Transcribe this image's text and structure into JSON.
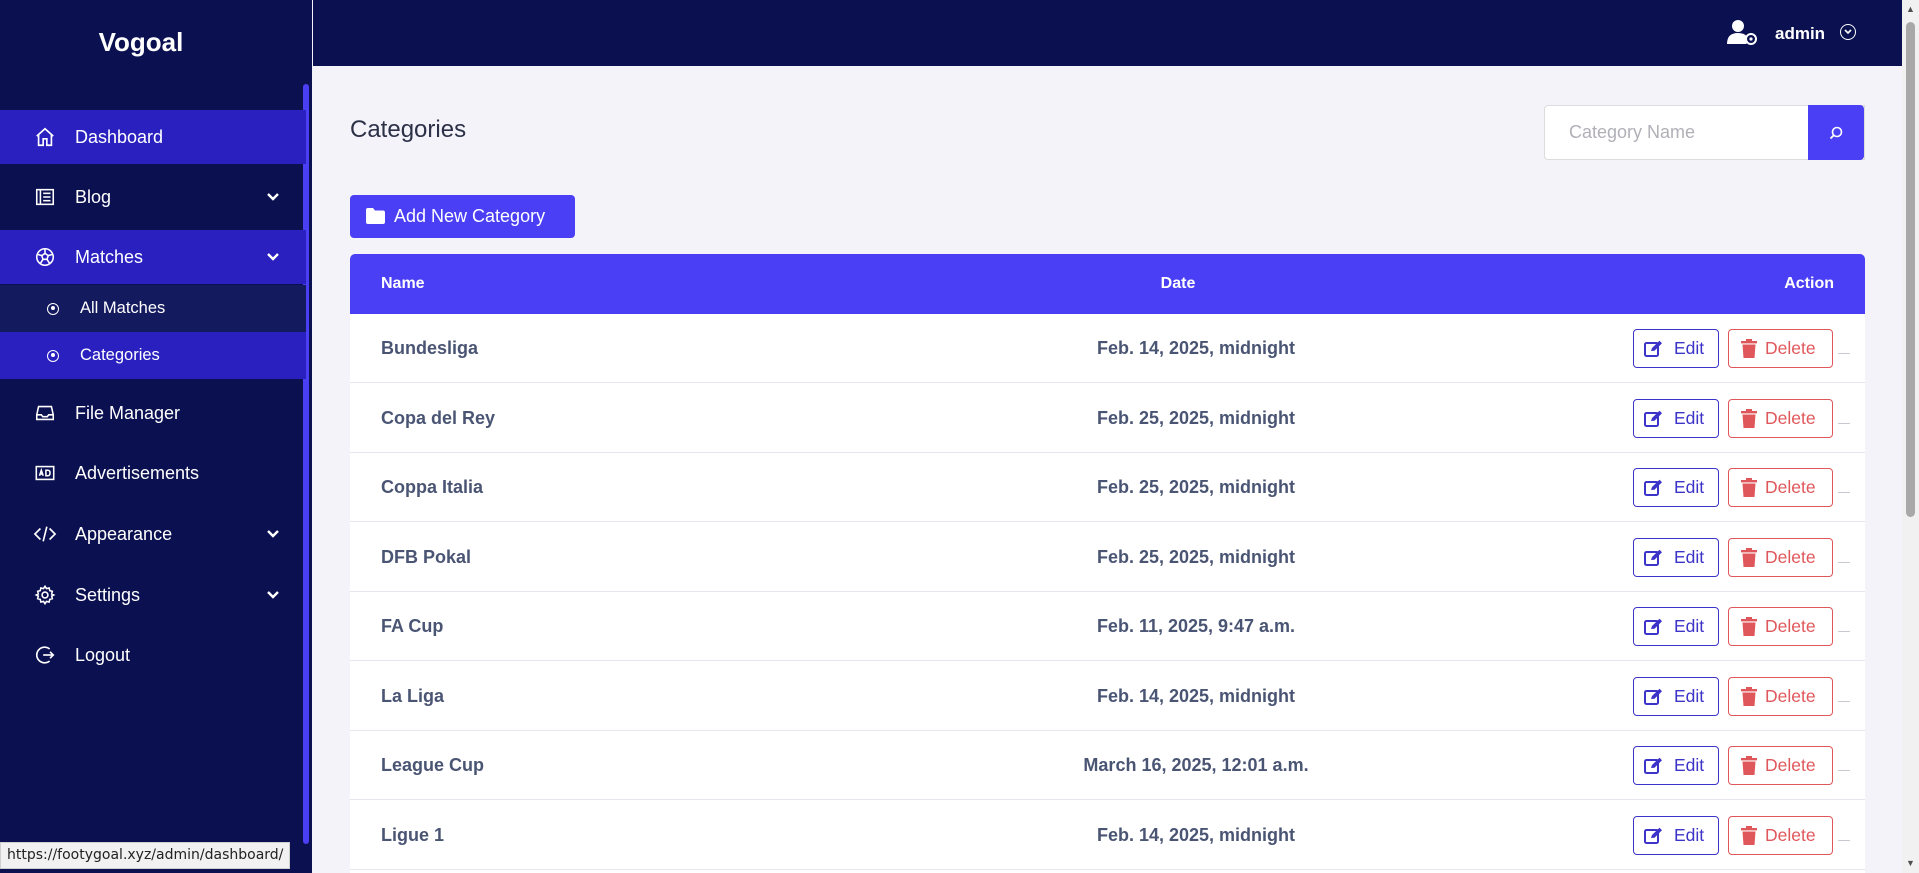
{
  "app": {
    "brand": "Vogoal"
  },
  "sidebar": {
    "items": [
      {
        "label": "Dashboard",
        "icon": "home-icon"
      },
      {
        "label": "Blog",
        "icon": "blog-icon"
      },
      {
        "label": "Matches",
        "icon": "soccer-ball-icon"
      },
      {
        "label": "File Manager",
        "icon": "inbox-icon"
      },
      {
        "label": "Advertisements",
        "icon": "ad-icon"
      },
      {
        "label": "Appearance",
        "icon": "code-icon"
      },
      {
        "label": "Settings",
        "icon": "gear-icon"
      },
      {
        "label": "Logout",
        "icon": "logout-icon"
      }
    ],
    "sub_items": [
      {
        "label": "All Matches"
      },
      {
        "label": "Categories"
      }
    ]
  },
  "topbar": {
    "user": "admin"
  },
  "main": {
    "title": "Categories",
    "search_placeholder": "Category Name",
    "add_button": "Add New Category",
    "columns": {
      "name": "Name",
      "date": "Date",
      "action": "Action"
    },
    "edit_label": "Edit",
    "delete_label": "Delete",
    "rows": [
      {
        "name": "Bundesliga",
        "date": "Feb. 14, 2025, midnight"
      },
      {
        "name": "Copa del Rey",
        "date": "Feb. 25, 2025, midnight"
      },
      {
        "name": "Coppa Italia",
        "date": "Feb. 25, 2025, midnight"
      },
      {
        "name": "DFB Pokal",
        "date": "Feb. 25, 2025, midnight"
      },
      {
        "name": "FA Cup",
        "date": "Feb. 11, 2025, 9:47 a.m."
      },
      {
        "name": "La Liga",
        "date": "Feb. 14, 2025, midnight"
      },
      {
        "name": "League Cup",
        "date": "March 16, 2025, 12:01 a.m."
      },
      {
        "name": "Ligue 1",
        "date": "Feb. 14, 2025, midnight"
      }
    ]
  },
  "status_bar": {
    "url": "https://footygoal.xyz/admin/dashboard/"
  },
  "colors": {
    "sidebar_bg": "#0b1150",
    "accent": "#4b3ff5",
    "active_item": "#2a20c0",
    "danger": "#e0575b",
    "page_bg": "#f3f3f9"
  }
}
